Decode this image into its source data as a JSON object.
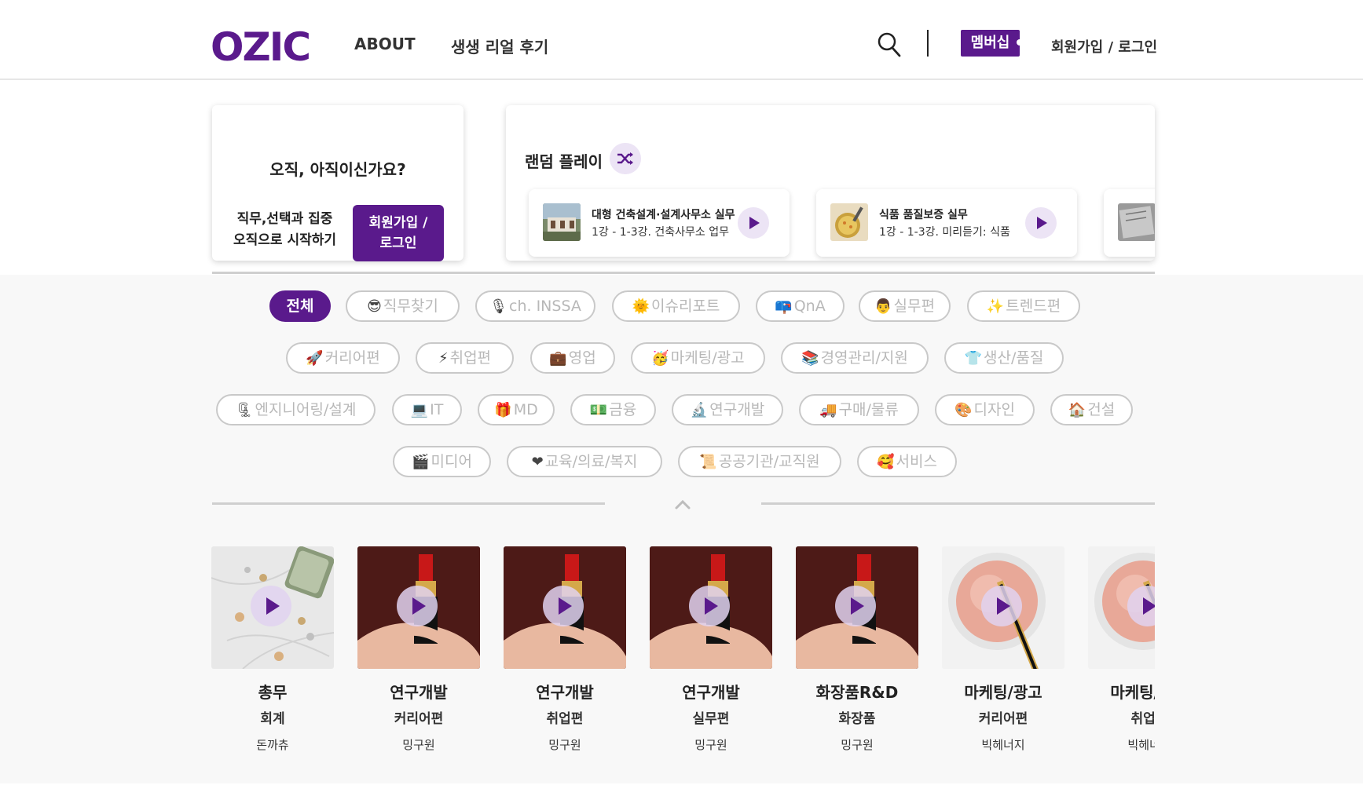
{
  "header": {
    "logo": "OZIC",
    "nav": [
      "ABOUT",
      "생생 리얼 후기"
    ],
    "membership": "멤버십",
    "login": "회원가입 / 로그인"
  },
  "signup_card": {
    "question": "오직, 아직이신가요?",
    "desc_line1": "직무,선택과 집중",
    "desc_line2": "오직으로 시작하기",
    "button_line1": "회원가입 /",
    "button_line2": "로그인"
  },
  "random_play": {
    "title": "랜덤 플레이",
    "items": [
      {
        "title": "대형 건축설계·설계사무소 실무",
        "subtitle": "1강 - 1-3강. 건축사무소 업무"
      },
      {
        "title": "식품 품질보증  실무",
        "subtitle": "1강 - 1-3강. 미리듣기: 식품"
      }
    ]
  },
  "categories": {
    "row1": [
      {
        "emoji": "😎",
        "label": "전체",
        "active": true
      },
      {
        "emoji": "😎",
        "label": "직무찾기"
      },
      {
        "emoji": "🎙",
        "label": "ch. INSSA"
      },
      {
        "emoji": "🌞",
        "label": "이슈리포트"
      },
      {
        "emoji": "📪",
        "label": "QnA"
      },
      {
        "emoji": "👨",
        "label": "실무편"
      },
      {
        "emoji": "✨",
        "label": "트렌드편"
      }
    ],
    "row2": [
      {
        "emoji": "🚀",
        "label": "커리어편"
      },
      {
        "emoji": "⚡",
        "label": "취업편"
      },
      {
        "emoji": "💼",
        "label": "영업"
      },
      {
        "emoji": "🥳",
        "label": "마케팅/광고"
      },
      {
        "emoji": "📚",
        "label": "경영관리/지원"
      },
      {
        "emoji": "👕",
        "label": "생산/품질"
      }
    ],
    "row3": [
      {
        "emoji": "🗜",
        "label": "엔지니어링/설계"
      },
      {
        "emoji": "💻",
        "label": "IT"
      },
      {
        "emoji": "🎁",
        "label": "MD"
      },
      {
        "emoji": "💵",
        "label": "금융"
      },
      {
        "emoji": "🔬",
        "label": "연구개발"
      },
      {
        "emoji": "🚚",
        "label": "구매/물류"
      },
      {
        "emoji": "🎨",
        "label": "디자인"
      },
      {
        "emoji": "🏠",
        "label": "건설"
      }
    ],
    "row4": [
      {
        "emoji": "🎬",
        "label": "미디어"
      },
      {
        "emoji": "❤",
        "label": "교육/의료/복지"
      },
      {
        "emoji": "📜",
        "label": "공공기관/교직원"
      },
      {
        "emoji": "🥰",
        "label": "서비스"
      }
    ]
  },
  "videos": [
    {
      "job": "총무",
      "sub": "회계",
      "author": "돈까츄",
      "thumb": "money"
    },
    {
      "job": "연구개발",
      "sub": "커리어편",
      "author": "밍구원",
      "thumb": "lipstick"
    },
    {
      "job": "연구개발",
      "sub": "취업편",
      "author": "밍구원",
      "thumb": "lipstick"
    },
    {
      "job": "연구개발",
      "sub": "실무편",
      "author": "밍구원",
      "thumb": "lipstick"
    },
    {
      "job": "화장품R&D",
      "sub": "화장품",
      "author": "밍구원",
      "thumb": "lipstick"
    },
    {
      "job": "마케팅/광고",
      "sub": "커리어편",
      "author": "빅헤너지",
      "thumb": "powder"
    },
    {
      "job": "마케팅/광고",
      "sub": "취업편",
      "author": "빅헤너지",
      "thumb": "powder"
    }
  ],
  "colors": {
    "brand": "#5a1a8c",
    "chip_border": "#c9c9c9",
    "bg_gray": "#f8f8f8"
  }
}
